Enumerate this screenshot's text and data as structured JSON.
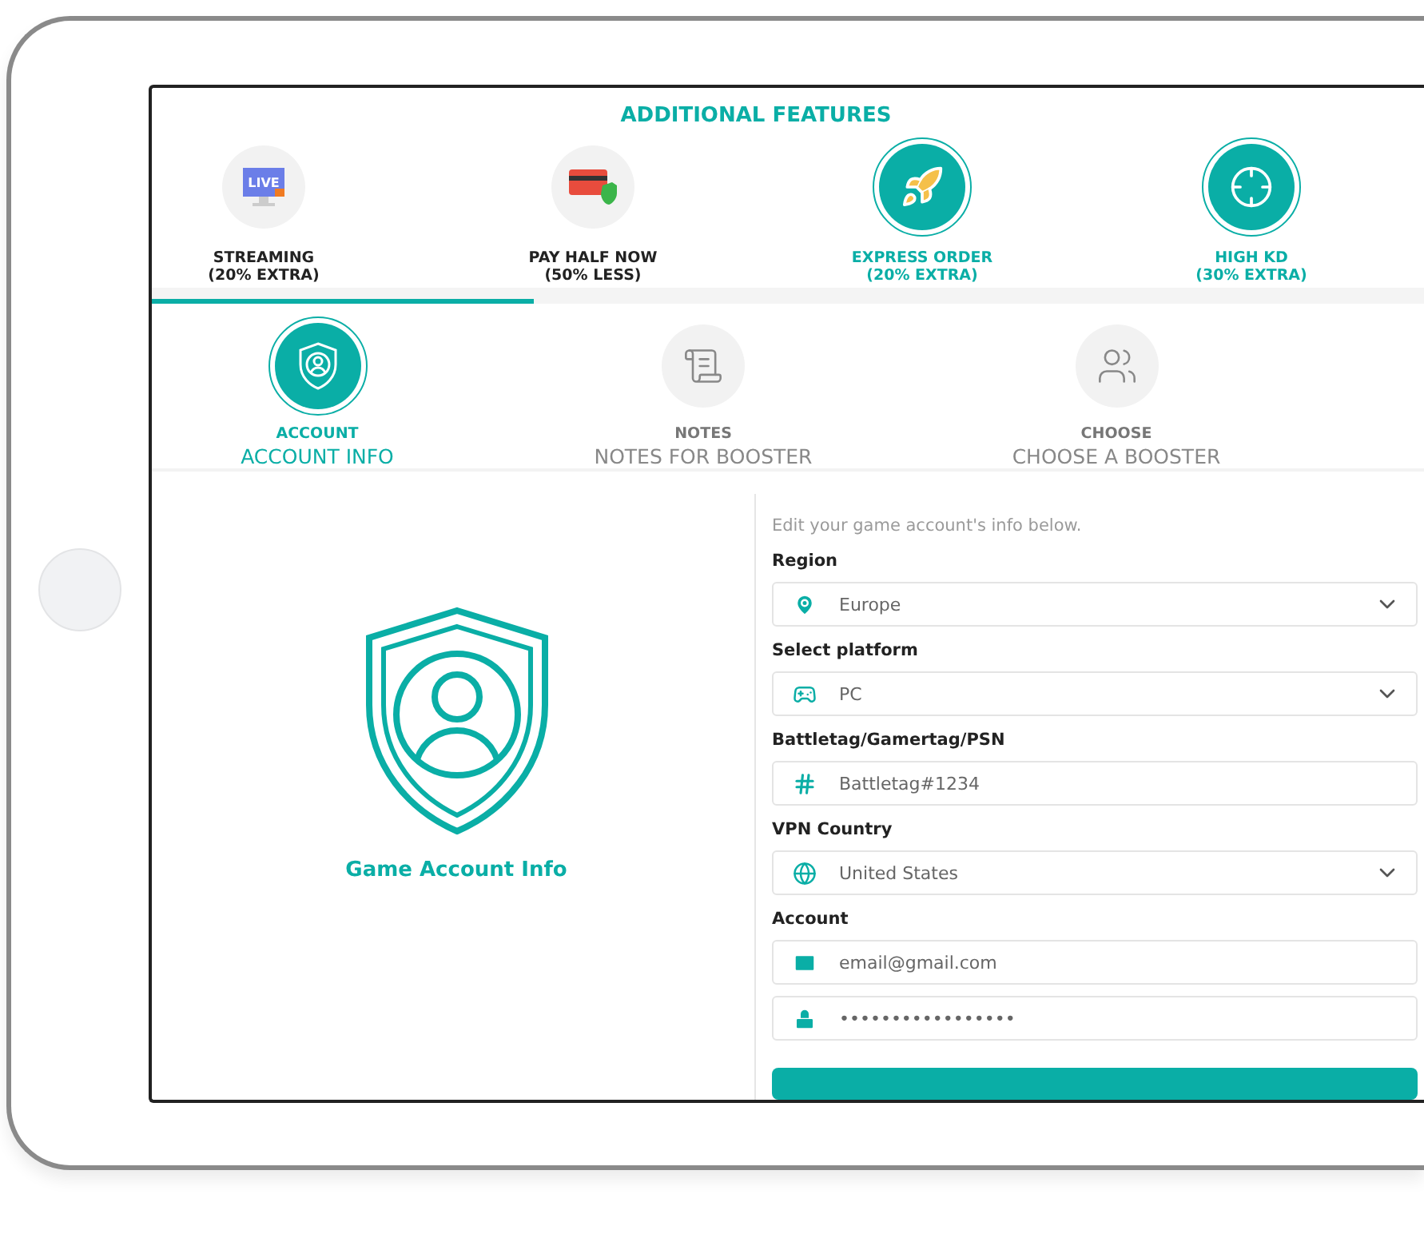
{
  "features": {
    "title": "ADDITIONAL FEATURES",
    "items": [
      {
        "label": "STREAMING",
        "note": "(20% EXTRA)",
        "selected": false,
        "screen_text": "LIVE"
      },
      {
        "label": "PAY HALF NOW",
        "note": "(50% LESS)",
        "selected": false
      },
      {
        "label": "EXPRESS ORDER",
        "note": "(20% EXTRA)",
        "selected": true
      },
      {
        "label": "HIGH KD",
        "note": "(30% EXTRA)",
        "selected": true
      }
    ]
  },
  "progress": {
    "level": 0.3
  },
  "steps": [
    {
      "title": "ACCOUNT",
      "subtitle": "ACCOUNT INFO",
      "selected": true
    },
    {
      "title": "NOTES",
      "subtitle": "NOTES FOR BOOSTER",
      "selected": false
    },
    {
      "title": "CHOOSE",
      "subtitle": "CHOOSE A BOOSTER",
      "selected": false
    }
  ],
  "account_panel": {
    "caption": "Game Account Info"
  },
  "form": {
    "intro": "Edit your game account's info below.",
    "fields": [
      {
        "label": "Region",
        "kind": "select",
        "value": "Europe"
      },
      {
        "label": "Select platform",
        "kind": "select",
        "value": "PC"
      },
      {
        "label": "Battletag/Gamertag/PSN",
        "kind": "text",
        "value": "Battletag#1234"
      },
      {
        "label": "VPN Country",
        "kind": "select",
        "value": "United States"
      },
      {
        "label": "Account",
        "kind": "text",
        "value": "email@gmail.com"
      },
      {
        "kind": "password",
        "value": "•••••••••••••••••"
      }
    ]
  }
}
